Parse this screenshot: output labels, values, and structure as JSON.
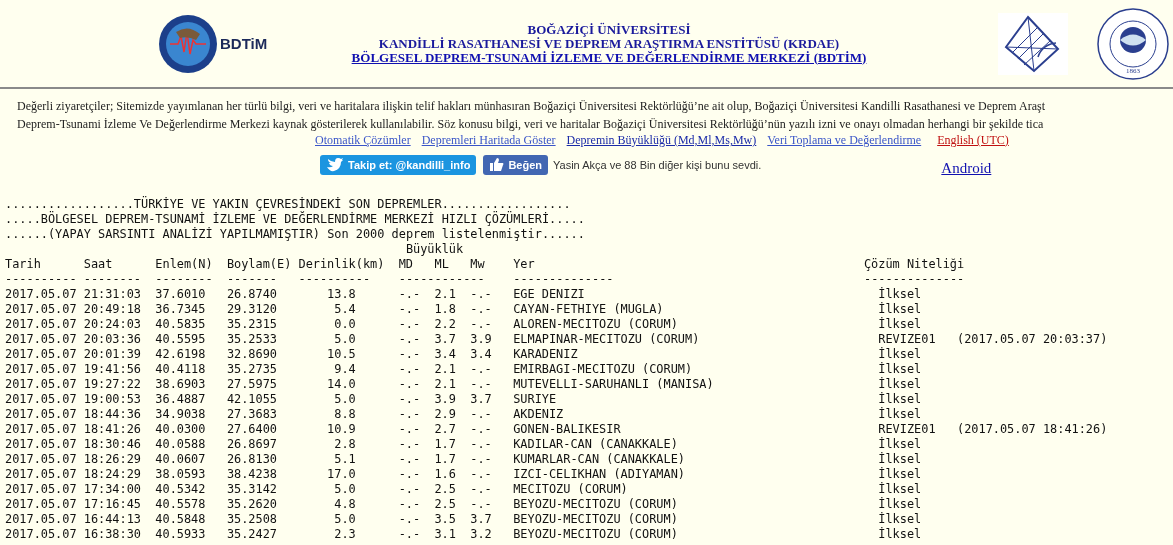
{
  "header": {
    "logo_text": "BDTiM",
    "titles": [
      "BOĞAZİÇİ ÜNİVERSİTESİ",
      "KANDİLLİ RASATHANESİ VE DEPREM ARAŞTIRMA ENSTİTÜSÜ (KRDAE)",
      "BÖLGESEL DEPREM-TSUNAMİ İZLEME VE DEĞERLENDİRME MERKEZİ (BDTİM)"
    ],
    "seal_year": "1863"
  },
  "notice": [
    "Değerli ziyaretçiler; Sitemizde yayımlanan her türlü bilgi, veri ve haritalara ilişkin telif hakları münhasıran Boğaziçi Üniversitesi Rektörlüğü’ne ait olup, Boğaziçi Üniversitesi Kandilli Rasathanesi ve Deprem Araşt",
    "Deprem-Tsunami İzleme Ve Değerlendirme Merkezi kaynak gösterilerek kullanılabilir. Söz konusu bilgi, veri ve haritalar Boğaziçi Üniversitesi Rektörlüğü’nün yazılı izni ve onayı olmadan herhangi bir şekilde tica"
  ],
  "links": [
    {
      "label": "Otomatik Çözümler",
      "kind": "normal"
    },
    {
      "label": "Depremleri Haritada Göster",
      "kind": "normal"
    },
    {
      "label": "Depremin Büyüklüğü (Md,Ml,Ms,Mw)",
      "kind": "current"
    },
    {
      "label": "Veri Toplama ve Değerlendirme",
      "kind": "normal"
    },
    {
      "label": "English (UTC)",
      "kind": "language"
    }
  ],
  "social": {
    "follow_button": "Takip et: @kandilli_info",
    "like_button": "Beğen",
    "like_text": "Yasin Akça ve 88 Bin diğer kişi bunu sevdi.",
    "android_link": "Android"
  },
  "listing": {
    "title_lines": [
      "..................TÜRKİYE VE YAKIN ÇEVRESİNDEKİ SON DEPREMLER..................",
      ".....BÖLGESEL DEPREM-TSUNAMİ İZLEME VE DEĞERLENDİRME MERKEZİ HIZLI ÇÖZÜMLERİ.....",
      "......(YAPAY SARSINTI ANALİZİ YAPILMAMIŞTIR) Son 2000 deprem listelenmiştir......"
    ],
    "group_header": "Büyüklük",
    "columns": [
      "Tarih",
      "Saat",
      "Enlem(N)",
      "Boylam(E)",
      "Derinlik(km)",
      "MD",
      "ML",
      "Mw",
      "Yer",
      "Çözüm Niteliği"
    ],
    "dash_line": "---------- --------  --------  -------   ----------    ------------    --------------                                   --------------",
    "rows": [
      {
        "date": "2017.05.07",
        "time": "21:31:03",
        "lat": "37.6010",
        "lon": "26.8740",
        "depth": "13.8",
        "md": "-.-",
        "ml": "2.1",
        "mw": "-.-",
        "place": "EGE DENIZI",
        "quality": "İlksel"
      },
      {
        "date": "2017.05.07",
        "time": "20:49:18",
        "lat": "36.7345",
        "lon": "29.3120",
        "depth": "5.4",
        "md": "-.-",
        "ml": "1.8",
        "mw": "-.-",
        "place": "CAYAN-FETHIYE (MUGLA)",
        "quality": "İlksel"
      },
      {
        "date": "2017.05.07",
        "time": "20:24:03",
        "lat": "40.5835",
        "lon": "35.2315",
        "depth": "0.0",
        "md": "-.-",
        "ml": "2.2",
        "mw": "-.-",
        "place": "ALOREN-MECITOZU (CORUM)",
        "quality": "İlksel"
      },
      {
        "date": "2017.05.07",
        "time": "20:03:36",
        "lat": "40.5595",
        "lon": "35.2533",
        "depth": "5.0",
        "md": "-.-",
        "ml": "3.7",
        "mw": "3.9",
        "place": "ELMAPINAR-MECITOZU (CORUM)",
        "quality": "REVIZE01",
        "revised": "(2017.05.07 20:03:37)"
      },
      {
        "date": "2017.05.07",
        "time": "20:01:39",
        "lat": "42.6198",
        "lon": "32.8690",
        "depth": "10.5",
        "md": "-.-",
        "ml": "3.4",
        "mw": "3.4",
        "place": "KARADENIZ",
        "quality": "İlksel"
      },
      {
        "date": "2017.05.07",
        "time": "19:41:56",
        "lat": "40.4118",
        "lon": "35.2735",
        "depth": "9.4",
        "md": "-.-",
        "ml": "2.1",
        "mw": "-.-",
        "place": "EMIRBAGI-MECITOZU (CORUM)",
        "quality": "İlksel"
      },
      {
        "date": "2017.05.07",
        "time": "19:27:22",
        "lat": "38.6903",
        "lon": "27.5975",
        "depth": "14.0",
        "md": "-.-",
        "ml": "2.1",
        "mw": "-.-",
        "place": "MUTEVELLI-SARUHANLI (MANISA)",
        "quality": "İlksel"
      },
      {
        "date": "2017.05.07",
        "time": "19:00:53",
        "lat": "36.4887",
        "lon": "42.1055",
        "depth": "5.0",
        "md": "-.-",
        "ml": "3.9",
        "mw": "3.7",
        "place": "SURIYE",
        "quality": "İlksel"
      },
      {
        "date": "2017.05.07",
        "time": "18:44:36",
        "lat": "34.9038",
        "lon": "27.3683",
        "depth": "8.8",
        "md": "-.-",
        "ml": "2.9",
        "mw": "-.-",
        "place": "AKDENIZ",
        "quality": "İlksel"
      },
      {
        "date": "2017.05.07",
        "time": "18:41:26",
        "lat": "40.0300",
        "lon": "27.6400",
        "depth": "10.9",
        "md": "-.-",
        "ml": "2.7",
        "mw": "-.-",
        "place": "GONEN-BALIKESIR",
        "quality": "REVIZE01",
        "revised": "(2017.05.07 18:41:26)"
      },
      {
        "date": "2017.05.07",
        "time": "18:30:46",
        "lat": "40.0588",
        "lon": "26.8697",
        "depth": "2.8",
        "md": "-.-",
        "ml": "1.7",
        "mw": "-.-",
        "place": "KADILAR-CAN (CANAKKALE)",
        "quality": "İlksel"
      },
      {
        "date": "2017.05.07",
        "time": "18:26:29",
        "lat": "40.0607",
        "lon": "26.8130",
        "depth": "5.1",
        "md": "-.-",
        "ml": "1.7",
        "mw": "-.-",
        "place": "KUMARLAR-CAN (CANAKKALE)",
        "quality": "İlksel"
      },
      {
        "date": "2017.05.07",
        "time": "18:24:29",
        "lat": "38.0593",
        "lon": "38.4238",
        "depth": "17.0",
        "md": "-.-",
        "ml": "1.6",
        "mw": "-.-",
        "place": "IZCI-CELIKHAN (ADIYAMAN)",
        "quality": "İlksel"
      },
      {
        "date": "2017.05.07",
        "time": "17:34:00",
        "lat": "40.5342",
        "lon": "35.3142",
        "depth": "5.0",
        "md": "-.-",
        "ml": "2.5",
        "mw": "-.-",
        "place": "MECITOZU (CORUM)",
        "quality": "İlksel"
      },
      {
        "date": "2017.05.07",
        "time": "17:16:45",
        "lat": "40.5578",
        "lon": "35.2620",
        "depth": "4.8",
        "md": "-.-",
        "ml": "2.5",
        "mw": "-.-",
        "place": "BEYOZU-MECITOZU (CORUM)",
        "quality": "İlksel"
      },
      {
        "date": "2017.05.07",
        "time": "16:44:13",
        "lat": "40.5848",
        "lon": "35.2508",
        "depth": "5.0",
        "md": "-.-",
        "ml": "3.5",
        "mw": "3.7",
        "place": "BEYOZU-MECITOZU (CORUM)",
        "quality": "İlksel"
      },
      {
        "date": "2017.05.07",
        "time": "16:38:30",
        "lat": "40.5933",
        "lon": "35.2427",
        "depth": "2.3",
        "md": "-.-",
        "ml": "3.1",
        "mw": "3.2",
        "place": "BEYOZU-MECITOZU (CORUM)",
        "quality": "İlksel"
      }
    ]
  }
}
